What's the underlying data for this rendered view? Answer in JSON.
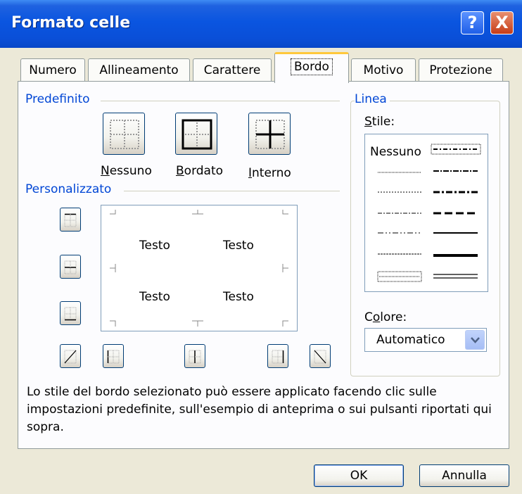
{
  "window": {
    "title": "Formato celle",
    "help_glyph": "?",
    "close_glyph": "X"
  },
  "tabs": [
    {
      "label": "Numero",
      "active": false
    },
    {
      "label": "Allineamento",
      "active": false
    },
    {
      "label": "Carattere",
      "active": false
    },
    {
      "label": "Bordo",
      "active": true
    },
    {
      "label": "Motivo",
      "active": false
    },
    {
      "label": "Protezione",
      "active": false
    }
  ],
  "predefinito": {
    "label": "Predefinito",
    "buttons": [
      {
        "label": "Nessuno",
        "accel": "N",
        "rest": "essuno",
        "icon": "border-none-icon"
      },
      {
        "label": "Bordato",
        "accel": "B",
        "rest": "ordato",
        "icon": "border-outline-icon"
      },
      {
        "label": "Interno",
        "accel": "I",
        "rest": "nterno",
        "icon": "border-inside-icon"
      }
    ]
  },
  "personalizzato": {
    "label": "Personalizzato",
    "preview_texts": [
      "Testo",
      "Testo",
      "Testo",
      "Testo"
    ]
  },
  "linea": {
    "label": "Linea",
    "stile_label": "Stile:",
    "stile_accel": "S",
    "stile_rest": "tile:",
    "none_option": "Nessuno",
    "colore_label": "Colore:",
    "colore_prefix": "C",
    "colore_accel": "o",
    "colore_rest": "lore:",
    "colore_value": "Automatico"
  },
  "description": "Lo stile del bordo selezionato può essere applicato facendo clic sulle impostazioni predefinite, sull'esempio di anteprima o sui pulsanti riportati qui sopra.",
  "buttons": {
    "ok": "OK",
    "cancel": "Annulla"
  },
  "colors": {
    "titlebar": "#0A55E0",
    "group_label": "#0046D5",
    "dialog_bg": "#ECE9D8",
    "active_tab_accent": "#FFC83C"
  }
}
